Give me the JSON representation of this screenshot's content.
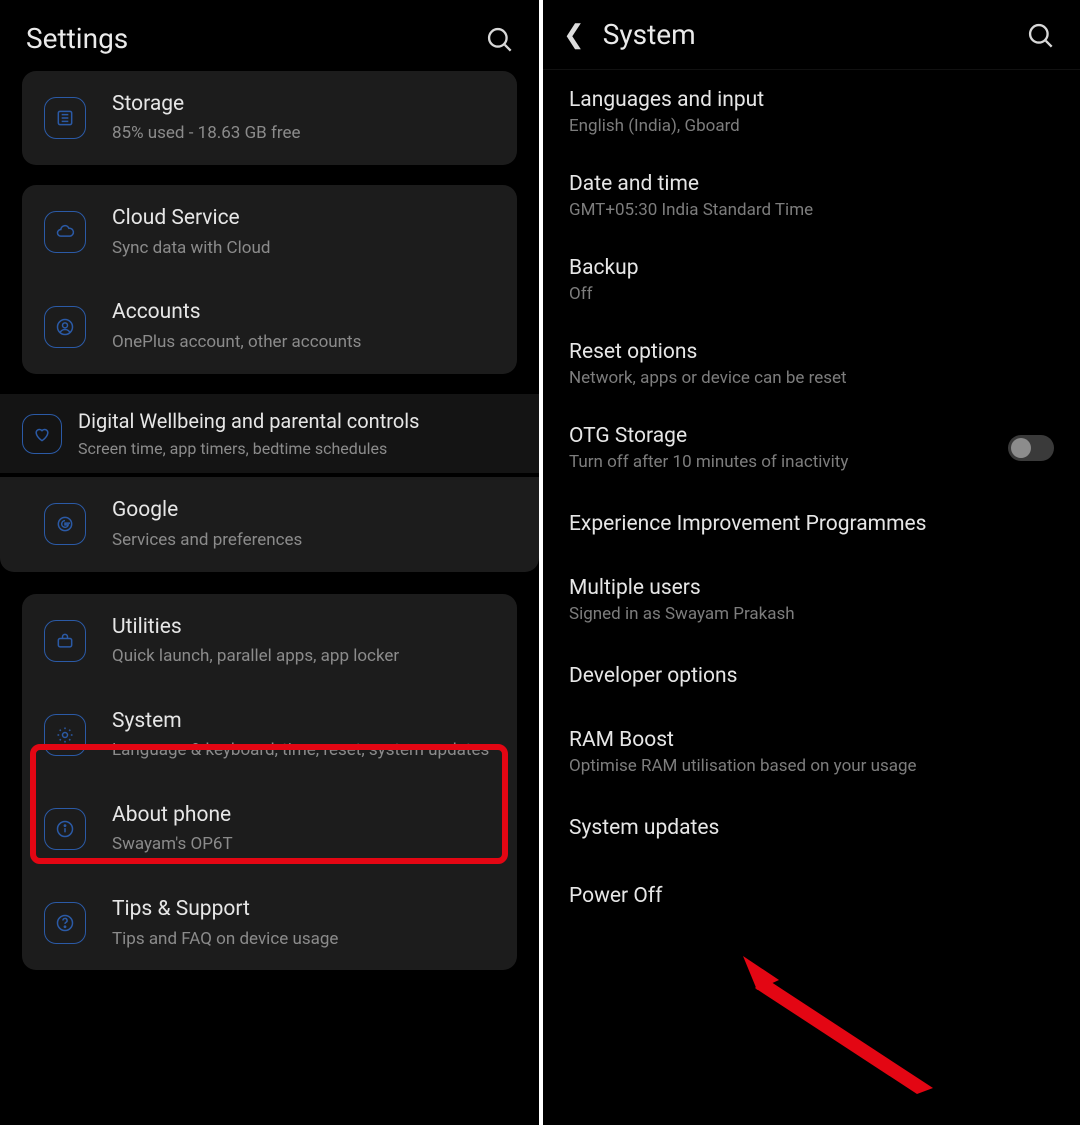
{
  "left": {
    "title": "Settings",
    "storage": {
      "title": "Storage",
      "sub": "85% used - 18.63 GB free"
    },
    "cloud": {
      "title": "Cloud Service",
      "sub": "Sync data with Cloud"
    },
    "accounts": {
      "title": "Accounts",
      "sub": "OnePlus account, other accounts"
    },
    "wellbeing": {
      "title": "Digital Wellbeing and parental controls",
      "sub": "Screen time, app timers, bedtime schedules"
    },
    "google": {
      "title": "Google",
      "sub": "Services and preferences"
    },
    "utilities": {
      "title": "Utilities",
      "sub": "Quick launch, parallel apps, app locker"
    },
    "system": {
      "title": "System",
      "sub": "Language & keyboard, time, reset, system updates"
    },
    "about": {
      "title": "About phone",
      "sub": "Swayam's OP6T"
    },
    "tips": {
      "title": "Tips & Support",
      "sub": "Tips and FAQ on device usage"
    }
  },
  "right": {
    "title": "System",
    "lang": {
      "title": "Languages and input",
      "sub": "English (India), Gboard"
    },
    "date": {
      "title": "Date and time",
      "sub": "GMT+05:30 India Standard Time"
    },
    "backup": {
      "title": "Backup",
      "sub": "Off"
    },
    "reset": {
      "title": "Reset options",
      "sub": "Network, apps or device can be reset"
    },
    "otg": {
      "title": "OTG Storage",
      "sub": "Turn off after 10 minutes of inactivity",
      "toggle": false
    },
    "exp": {
      "title": "Experience Improvement Programmes"
    },
    "users": {
      "title": "Multiple users",
      "sub": "Signed in as Swayam Prakash"
    },
    "dev": {
      "title": "Developer options"
    },
    "ram": {
      "title": "RAM Boost",
      "sub": "Optimise RAM utilisation based on your usage"
    },
    "updates": {
      "title": "System updates"
    },
    "power": {
      "title": "Power Off"
    }
  }
}
